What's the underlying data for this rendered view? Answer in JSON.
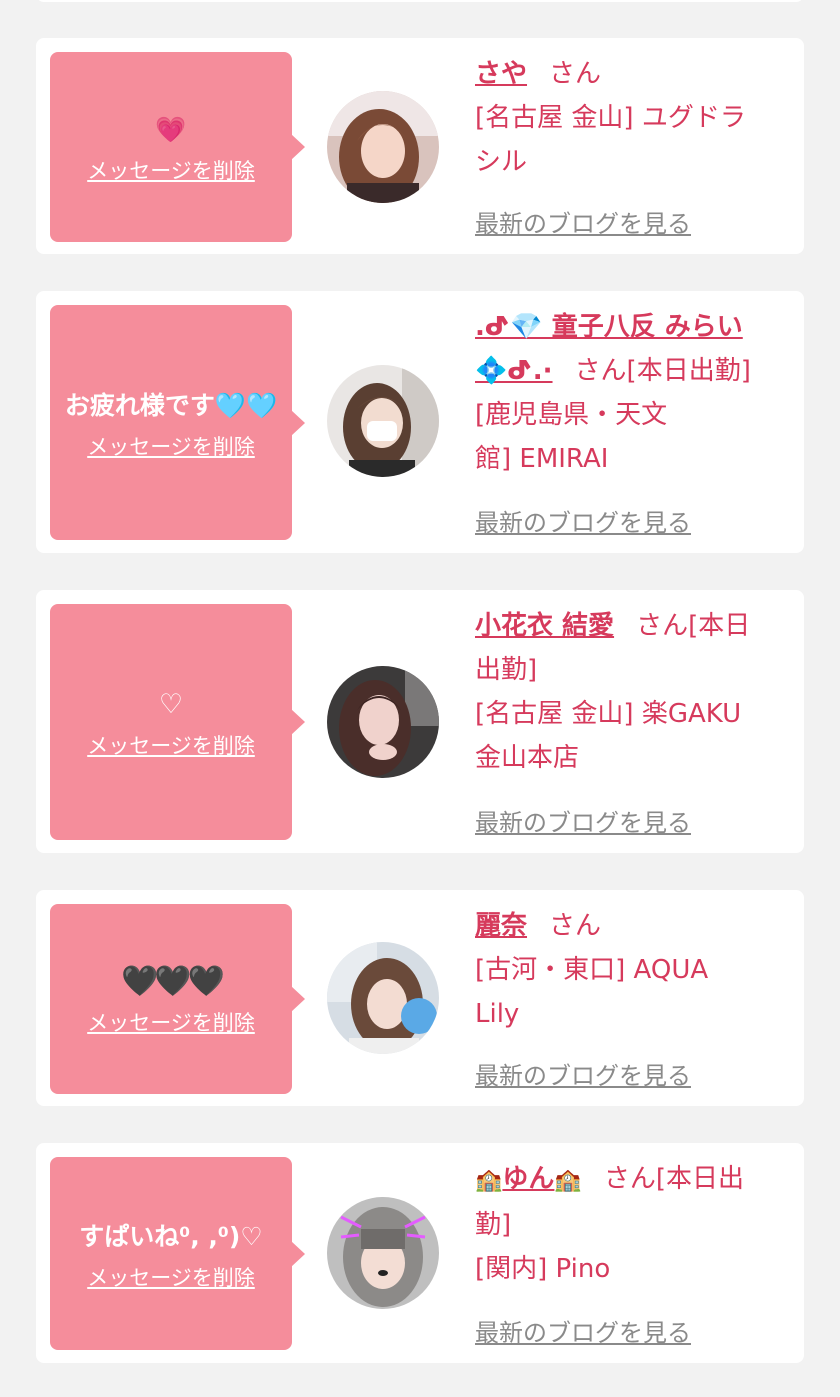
{
  "common": {
    "delete_label": "メッセージを削除",
    "blog_label": "最新のブログを見る",
    "san": "さん"
  },
  "colors": {
    "bubble": "#f58d9b",
    "name_text": "#d63a5c",
    "link_gray": "#8a8a8a",
    "background": "#f2f2f2"
  },
  "messages": [
    {
      "message": "💗",
      "name": "さや",
      "suffix": "",
      "shop_line1": "[名古屋 金山] ユグドラ",
      "shop_line2": "シル"
    },
    {
      "message": "お疲れ様です🩵🩵",
      "name_part1": ".ᕷ💎 童子八反 みらい",
      "name_part2": "💠ᕷ.·",
      "suffix": "[本日出勤]",
      "shop_line1": "[鹿児島県・天文",
      "shop_line2": "館] EMIRAI"
    },
    {
      "message": "♡",
      "name": "小花衣 結愛",
      "suffix": "[本日",
      "suffix2": "出勤]",
      "shop_line1": "[名古屋 金山] 楽GAKU",
      "shop_line2": "金山本店"
    },
    {
      "message": "🖤🖤🖤",
      "name": "麗奈",
      "suffix": "",
      "shop_line1": "[古河・東口] AQUA",
      "shop_line2": "Lily"
    },
    {
      "message": "すぱいね⁰, ,⁰)♡",
      "name": "ゆん",
      "name_icon": "🏫",
      "suffix": "[本日出",
      "suffix2": "勤]",
      "shop_line1": "[関内] Pino"
    }
  ]
}
